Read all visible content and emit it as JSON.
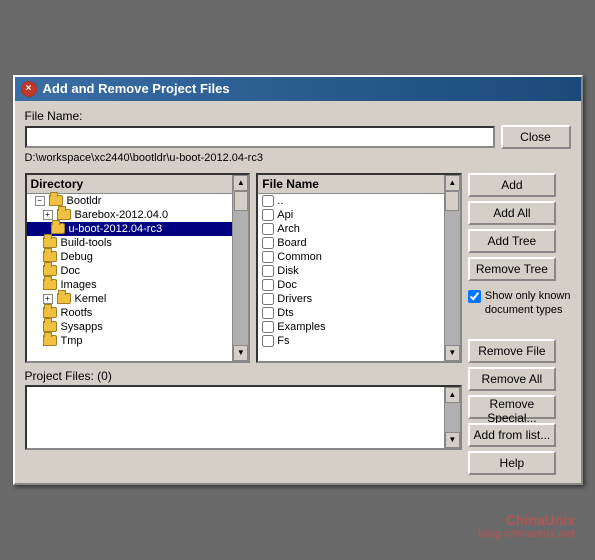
{
  "window": {
    "title": "Add and Remove Project Files",
    "close_btn": "×"
  },
  "file_name_label": "File Name:",
  "file_name_value": "",
  "current_path": "D:\\workspace\\xc2440\\bootldr\\u-boot-2012.04-rc3",
  "close_button": "Close",
  "directory_panel": {
    "header": "Directory",
    "items": [
      {
        "label": "Bootldr",
        "indent": 1,
        "type": "folder",
        "expanded": true,
        "has_expand": true
      },
      {
        "label": "Barebox-2012.04.0",
        "indent": 2,
        "type": "folder",
        "expanded": true,
        "has_expand": true
      },
      {
        "label": "u-boot-2012.04-rc3",
        "indent": 3,
        "type": "folder",
        "selected": true,
        "has_expand": false
      },
      {
        "label": "Build-tools",
        "indent": 2,
        "type": "folder",
        "has_expand": false
      },
      {
        "label": "Debug",
        "indent": 2,
        "type": "folder",
        "has_expand": false
      },
      {
        "label": "Doc",
        "indent": 2,
        "type": "folder",
        "has_expand": false
      },
      {
        "label": "Images",
        "indent": 2,
        "type": "folder",
        "has_expand": false
      },
      {
        "label": "Kernel",
        "indent": 2,
        "type": "folder",
        "expanded": false,
        "has_expand": true
      },
      {
        "label": "Rootfs",
        "indent": 2,
        "type": "folder",
        "has_expand": false
      },
      {
        "label": "Sysapps",
        "indent": 2,
        "type": "folder",
        "has_expand": false
      },
      {
        "label": "Tmp",
        "indent": 2,
        "type": "folder",
        "has_expand": false
      }
    ]
  },
  "file_name_panel": {
    "header": "File Name",
    "items": [
      {
        "label": "..",
        "checked": false
      },
      {
        "label": "Api",
        "checked": false
      },
      {
        "label": "Arch",
        "checked": false
      },
      {
        "label": "Board",
        "checked": false
      },
      {
        "label": "Common",
        "checked": false
      },
      {
        "label": "Disk",
        "checked": false
      },
      {
        "label": "Doc",
        "checked": false
      },
      {
        "label": "Drivers",
        "checked": false
      },
      {
        "label": "Dts",
        "checked": false
      },
      {
        "label": "Examples",
        "checked": false
      },
      {
        "label": "Fs",
        "checked": false
      }
    ]
  },
  "right_buttons": {
    "add": "Add",
    "add_all": "Add All",
    "add_tree": "Add Tree",
    "remove_tree": "Remove Tree"
  },
  "show_only_checkbox": {
    "checked": true,
    "label": "Show only known\ndocument types"
  },
  "project_files": {
    "header": "Project Files: (0)",
    "items": []
  },
  "bottom_buttons": {
    "remove_file": "Remove File",
    "remove_all": "Remove All",
    "remove_special": "Remove Special...",
    "add_from_list": "Add from list...",
    "help": "Help"
  },
  "watermark": {
    "line1": "ChinaUnix",
    "line2": "blog.chinaunix.net"
  }
}
